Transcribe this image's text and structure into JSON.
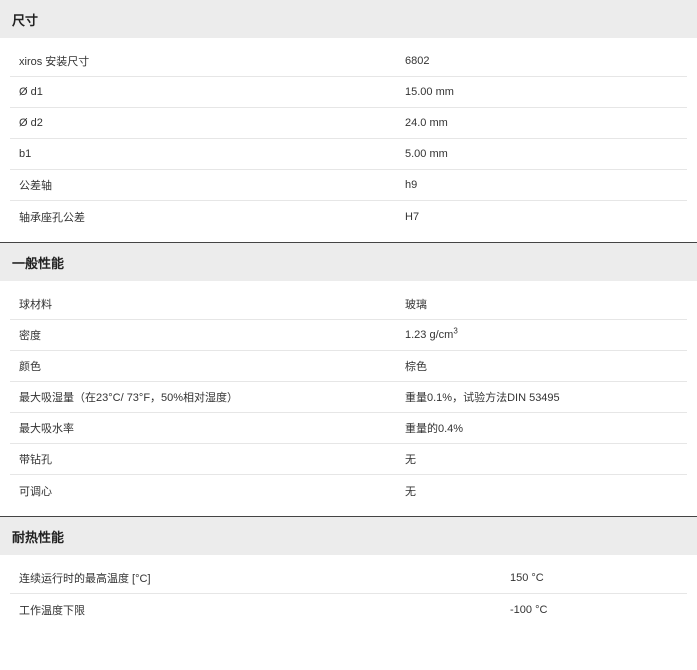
{
  "sections": [
    {
      "title": "尺寸",
      "rows": [
        {
          "label": "xiros 安装尺寸",
          "value": "6802"
        },
        {
          "label": "Ø d1",
          "value": "15.00 mm"
        },
        {
          "label": "Ø d2",
          "value": "24.0 mm"
        },
        {
          "label": "b1",
          "value": "5.00 mm"
        },
        {
          "label": "公差轴",
          "value": "h9"
        },
        {
          "label": "轴承座孔公差",
          "value": "H7"
        }
      ]
    },
    {
      "title": "一般性能",
      "rows": [
        {
          "label": "球材料",
          "value": "玻璃"
        },
        {
          "label": "密度",
          "value": "1.23 g/cm",
          "value_sup": "3"
        },
        {
          "label": "颜色",
          "value": "棕色"
        },
        {
          "label": "最大吸湿量（在23°C/ 73°F，50%相对湿度）",
          "value": "重量0.1%，试验方法DIN 53495"
        },
        {
          "label": "最大吸水率",
          "value": "重量的0.4%"
        },
        {
          "label": "带钻孔",
          "value": "无"
        },
        {
          "label": "可调心",
          "value": "无"
        }
      ]
    },
    {
      "title": "耐热性能",
      "rows": [
        {
          "label": "连续运行时的最高温度 [°C]",
          "value": "150 °C"
        },
        {
          "label": "工作温度下限",
          "value": "-100 °C"
        }
      ]
    }
  ]
}
